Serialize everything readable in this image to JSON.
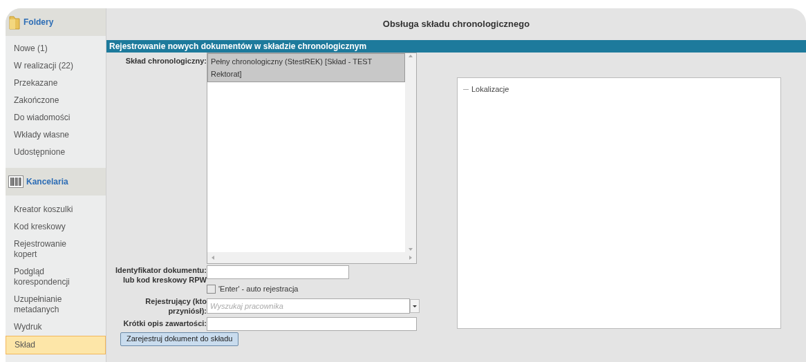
{
  "sidebar": {
    "sections": [
      {
        "title": "Foldery",
        "kind": "folder",
        "items": [
          {
            "label": "Nowe (1)",
            "selected": false
          },
          {
            "label": "W realizacji (22)",
            "selected": false
          },
          {
            "label": "Przekazane",
            "selected": false
          },
          {
            "label": "Zakończone",
            "selected": false
          },
          {
            "label": "Do wiadomości",
            "selected": false
          },
          {
            "label": "Wkłady własne",
            "selected": false
          },
          {
            "label": "Udostępnione",
            "selected": false
          }
        ]
      },
      {
        "title": "Kancelaria",
        "kind": "barcode",
        "items": [
          {
            "label": "Kreator koszulki",
            "selected": false
          },
          {
            "label": "Kod kreskowy",
            "selected": false
          },
          {
            "label": "Rejestrowanie kopert",
            "selected": false
          },
          {
            "label": "Podgląd korespondencji",
            "selected": false
          },
          {
            "label": "Uzupełnianie metadanych",
            "selected": false
          },
          {
            "label": "Wydruk",
            "selected": false
          },
          {
            "label": "Skład",
            "selected": true
          }
        ]
      }
    ]
  },
  "main": {
    "title": "Obsługa składu chronologicznego",
    "section_title": "Rejestrowanie nowych dokumentów w składzie chronologicznym",
    "store_label": "Skład chronologiczny:",
    "store_options": [
      {
        "label": "Pełny chronologiczny (StestREK) [Skład - TEST Rektorat]",
        "selected": true
      }
    ],
    "id_label": "Identyfikator dokumentu: lub kod kreskowy RPW",
    "auto_checkbox": {
      "label": "'Enter' - auto rejestracja",
      "checked": false
    },
    "registrant_label": "Rejestrujący (kto przyniósł):",
    "registrant_placeholder": "Wyszukaj pracownika",
    "description_label": "Krótki opis zawartości:",
    "submit": "Zarejestruj dokument do składu",
    "tree": {
      "label": "Lokalizacje"
    }
  }
}
